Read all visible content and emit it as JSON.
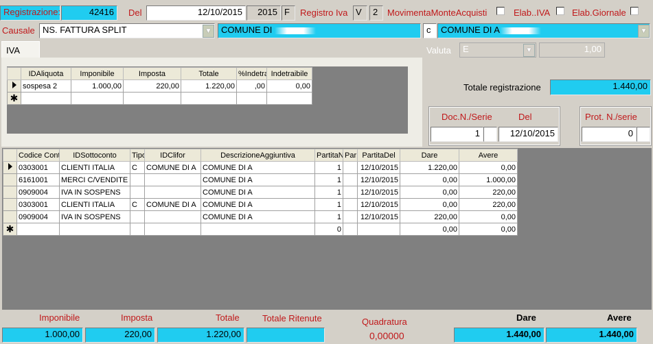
{
  "header": {
    "registrazione_label": "Registrazione:",
    "registrazione_value": "42416",
    "del_label": "Del",
    "date_value": "12/10/2015",
    "year_value": "2015",
    "f_value": "F",
    "registro_iva_label": "Registro Iva",
    "registro_v": "V",
    "registro_num": "2",
    "movimenta_label": "MovimentaMonteAcquisti",
    "elab_iva_label": "Elab..IVA",
    "elab_giornale_label": "Elab.Giornale"
  },
  "causale": {
    "label": "Causale",
    "value": "NS. FATTURA SPLIT",
    "desc_value": "COMUNE DI",
    "c_value": "c",
    "cliente_value": "COMUNE DI A"
  },
  "tab": {
    "label": "IVA"
  },
  "valuta": {
    "label": "Valuta",
    "value": "E",
    "rate": "1,00"
  },
  "totale_registrazione": {
    "label": "Totale registrazione",
    "value": "1.440,00"
  },
  "doc": {
    "label_num": "Doc.N./Serie",
    "label_del": "Del",
    "num": "1",
    "date": "12/10/2015",
    "prot_label": "Prot. N./serie",
    "prot_value": "0"
  },
  "iva_table": {
    "headers": [
      "IDAliquota",
      "Imponibile",
      "Imposta",
      "Totale",
      "%Indetra",
      "Indetraibile"
    ],
    "rows": [
      [
        "sospesa 2",
        "1.000,00",
        "220,00",
        "1.220,00",
        ",00",
        "0,00"
      ]
    ]
  },
  "entries_table": {
    "headers": [
      "Codice Cont",
      "IDSottoconto",
      "Tipo",
      "IDClifor",
      "DescrizioneAggiuntiva",
      "PartitaN",
      "Par",
      "PartitaDel",
      "Dare",
      "Avere"
    ],
    "rows": [
      [
        "0303001",
        "CLIENTI ITALIA",
        "C",
        "COMUNE DI A",
        "COMUNE DI A",
        "1",
        "",
        "12/10/2015",
        "1.220,00",
        "0,00"
      ],
      [
        "6161001",
        "MERCI C/VENDITE",
        "",
        "",
        "COMUNE DI A",
        "1",
        "",
        "12/10/2015",
        "0,00",
        "1.000,00"
      ],
      [
        "0909004",
        "IVA IN SOSPENS",
        "",
        "",
        "COMUNE DI A",
        "1",
        "",
        "12/10/2015",
        "0,00",
        "220,00"
      ],
      [
        "0303001",
        "CLIENTI ITALIA",
        "C",
        "COMUNE DI A",
        "COMUNE DI A",
        "1",
        "",
        "12/10/2015",
        "0,00",
        "220,00"
      ],
      [
        "0909004",
        "IVA IN SOSPENS",
        "",
        "",
        "COMUNE DI A",
        "1",
        "",
        "12/10/2015",
        "220,00",
        "0,00"
      ]
    ],
    "new_row": [
      "",
      "",
      "",
      "",
      "",
      "0",
      "",
      "",
      "0,00",
      "0,00"
    ]
  },
  "footer": {
    "imponibile_label": "Imponibile",
    "imponibile_value": "1.000,00",
    "imposta_label": "Imposta",
    "imposta_value": "220,00",
    "totale_label": "Totale",
    "totale_value": "1.220,00",
    "ritenute_label": "Totale Ritenute",
    "ritenute_value": "",
    "quadratura_label": "Quadratura",
    "quadratura_value": "0,00000",
    "dare_label": "Dare",
    "dare_value": "1.440,00",
    "avere_label": "Avere",
    "avere_value": "1.440,00"
  },
  "colors": {
    "accent_cyan": "#20ccf0",
    "label_red": "#c0181a"
  }
}
